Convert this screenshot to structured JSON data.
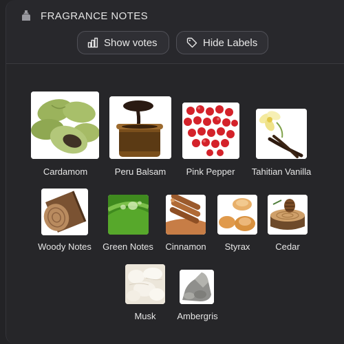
{
  "section": {
    "title": "FRAGRANCE NOTES",
    "show_votes_label": "Show votes",
    "hide_labels_label": "Hide Labels"
  },
  "notes": [
    {
      "label": "Cardamom",
      "icon": "cardamom-image"
    },
    {
      "label": "Peru Balsam",
      "icon": "peru-balsam-image"
    },
    {
      "label": "Pink Pepper",
      "icon": "pink-pepper-image"
    },
    {
      "label": "Tahitian Vanilla",
      "icon": "tahitian-vanilla-image"
    },
    {
      "label": "Woody Notes",
      "icon": "woody-notes-image"
    },
    {
      "label": "Green Notes",
      "icon": "green-notes-image"
    },
    {
      "label": "Cinnamon",
      "icon": "cinnamon-image"
    },
    {
      "label": "Styrax",
      "icon": "styrax-image"
    },
    {
      "label": "Cedar",
      "icon": "cedar-image"
    },
    {
      "label": "Musk",
      "icon": "musk-image"
    },
    {
      "label": "Ambergris",
      "icon": "ambergris-image"
    }
  ],
  "colors": {
    "background": "#232326",
    "button_border": "#505057",
    "text": "#e6e6e6"
  }
}
